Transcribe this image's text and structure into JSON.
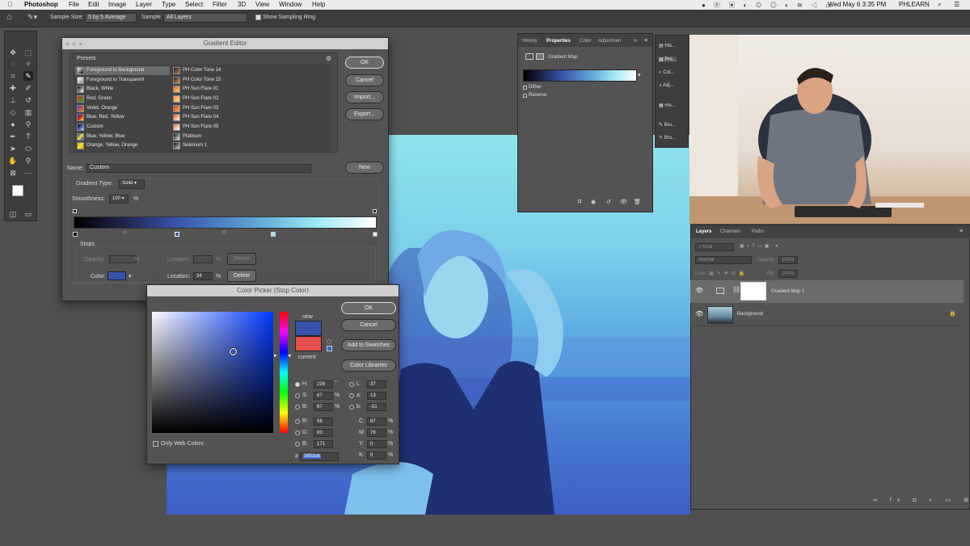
{
  "menubar": {
    "app": "Photoshop",
    "items": [
      "File",
      "Edit",
      "Image",
      "Layer",
      "Type",
      "Select",
      "Filter",
      "3D",
      "View",
      "Window",
      "Help"
    ],
    "clock": "Wed May 6  3:35 PM",
    "user": "PHLEARN"
  },
  "options": {
    "sample_size_label": "Sample Size:",
    "sample_size_value": "5 by 5 Average",
    "sample_label": "Sample:",
    "sample_value": "All Layers",
    "ring_label": "Show Sampling Ring"
  },
  "gradient_editor": {
    "title": "Gradient Editor",
    "presets_label": "Presets",
    "presets_left": [
      "Foreground to Background",
      "Foreground to Transparent",
      "Black, White",
      "Red, Green",
      "Violet, Orange",
      "Blue, Red, Yellow",
      "Custom",
      "Blue, Yellow, Blue",
      "Orange, Yellow, Orange"
    ],
    "presets_right": [
      "PH Color Tone 14",
      "PH Color Tone 15",
      "PH Sun Flare 01",
      "PH Sun Flare 02",
      "PH Sun Flare 03",
      "PH Sun Flare 04",
      "PH Sun Flare 05",
      "Platinum",
      "Selenium 1"
    ],
    "ok": "OK",
    "cancel": "Cancel",
    "import": "Import...",
    "export": "Export...",
    "name_label": "Name:",
    "name_value": "Custom",
    "new": "New",
    "type_label": "Gradient Type:",
    "type_value": "Solid",
    "smoothness_label": "Smoothness:",
    "smoothness_value": "100",
    "pct": "%",
    "stops_label": "Stops",
    "opacity_label": "Opacity:",
    "location_label": "Location:",
    "delete": "Delete",
    "color_label": "Color:",
    "color_location_value": "34"
  },
  "color_picker": {
    "title": "Color Picker (Stop Color)",
    "ok": "OK",
    "cancel": "Cancel",
    "add_swatches": "Add to Swatches",
    "libraries": "Color Libraries",
    "new_label": "new",
    "current_label": "current",
    "web_colors": "Only Web Colors",
    "hsb": [
      {
        "k": "H:",
        "v": "226",
        "u": "°"
      },
      {
        "k": "S:",
        "v": "67",
        "u": "%"
      },
      {
        "k": "B:",
        "v": "67",
        "u": "%"
      }
    ],
    "rgb": [
      {
        "k": "R:",
        "v": "56"
      },
      {
        "k": "G:",
        "v": "83"
      },
      {
        "k": "B:",
        "v": "171"
      }
    ],
    "lab": [
      {
        "k": "L:",
        "v": "37"
      },
      {
        "k": "a:",
        "v": "13"
      },
      {
        "k": "b:",
        "v": "-51"
      }
    ],
    "cmyk": [
      {
        "k": "C:",
        "v": "87",
        "u": "%"
      },
      {
        "k": "M:",
        "v": "76",
        "u": "%"
      },
      {
        "k": "Y:",
        "v": "0",
        "u": "%"
      },
      {
        "k": "K:",
        "v": "0",
        "u": "%"
      }
    ],
    "hash": "#",
    "hex": "3853ab",
    "new_color": "#3853ab",
    "current_color": "#e5504d"
  },
  "properties": {
    "tabs": [
      "History",
      "Properties",
      "Color",
      "Adjustmen"
    ],
    "title": "Gradient Map",
    "dither": "Dither",
    "reverse": "Reverse"
  },
  "mini_panels": [
    "His...",
    "Pro...",
    "Col...",
    "Adj...",
    "His...",
    "Bru...",
    "Bru..."
  ],
  "layers": {
    "tabs": [
      "Layers",
      "Channels",
      "Paths"
    ],
    "kind": "Kind",
    "mode": "Normal",
    "opacity_label": "Opacity:",
    "opacity_value": "100%",
    "lock_label": "Lock:",
    "fill_label": "Fill:",
    "fill_value": "100%",
    "items": [
      "Gradient Map 1",
      "Background"
    ]
  }
}
